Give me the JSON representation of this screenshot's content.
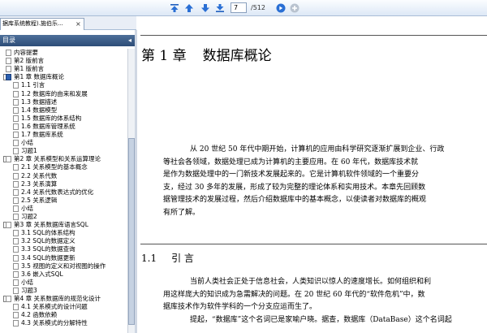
{
  "toolbar": {
    "current_page": "7",
    "page_total": "/512"
  },
  "tab": {
    "title": "据库系统教程).施伯乐...",
    "close": "×"
  },
  "sidebar": {
    "title": "目录",
    "collapse": "◂",
    "items": [
      {
        "label": "内容提要",
        "level": 0,
        "expander": ""
      },
      {
        "label": "第2 版前言",
        "level": 0,
        "expander": ""
      },
      {
        "label": "第1 版前言",
        "level": 0,
        "expander": ""
      },
      {
        "label": "第1 章  数据库概论",
        "level": 0,
        "expander": "-",
        "selected": true
      },
      {
        "label": "1.1  引言",
        "level": 1
      },
      {
        "label": "1.2  数据库的由来和发展",
        "level": 1
      },
      {
        "label": "1.3  数据描述",
        "level": 1
      },
      {
        "label": "1.4  数据模型",
        "level": 1
      },
      {
        "label": "1.5  数据库的体系结构",
        "level": 1
      },
      {
        "label": "1.6  数据库管理系统",
        "level": 1
      },
      {
        "label": "1.7  数据库系统",
        "level": 1
      },
      {
        "label": "小结",
        "level": 1
      },
      {
        "label": "习题1",
        "level": 1
      },
      {
        "label": "第2 章  关系模型和关系运算理论",
        "level": 0,
        "expander": "-"
      },
      {
        "label": "2.1  关系模型的基本概念",
        "level": 1
      },
      {
        "label": "2.2  关系代数",
        "level": 1
      },
      {
        "label": "2.3  关系演算",
        "level": 1
      },
      {
        "label": "2.4  关系代数表达式的优化",
        "level": 1
      },
      {
        "label": "2.5  关系逻辑",
        "level": 1
      },
      {
        "label": "小结",
        "level": 1
      },
      {
        "label": "习题2",
        "level": 1
      },
      {
        "label": "第3 章  关系数据库语言SQL",
        "level": 0,
        "expander": "-"
      },
      {
        "label": "3.1  SQL的体系结构",
        "level": 1
      },
      {
        "label": "3.2  SQL的数据定义",
        "level": 1
      },
      {
        "label": "3.3  SQL的数据查询",
        "level": 1
      },
      {
        "label": "3.4  SQL的数据更新",
        "level": 1
      },
      {
        "label": "3.5  视图的定义和对视图的操作",
        "level": 1
      },
      {
        "label": "3.6  嵌入式SQL",
        "level": 1
      },
      {
        "label": "小结",
        "level": 1
      },
      {
        "label": "习题3",
        "level": 1
      },
      {
        "label": "第4 章  关系数据库的规范化设计",
        "level": 0,
        "expander": "-"
      },
      {
        "label": "4.1  关系模式的设计问题",
        "level": 1
      },
      {
        "label": "4.2  函数依赖",
        "level": 1
      },
      {
        "label": "4.3  关系模式的分解特性",
        "level": 1
      }
    ]
  },
  "document": {
    "chapter_num": "第 1 章",
    "chapter_name": "数据库概论",
    "intro_lines": [
      "从 20 世纪 50 年代中期开始，计算机的应用由科学研究逐渐扩展到企业、行政",
      "等社会各领域，数据处理已成为计算机的主要应用。在 60 年代，数据库技术就",
      "是作为数据处理中的一门新技术发展起来的。它是计算机软件领域的一个重要分",
      "支，经过 30 多年的发展，形成了较为完整的理论体系和实用技术。本章先回顾数",
      "据管理技术的发展过程，然后介绍数据库中的基本概念，以使读者对数据库的概观",
      "有所了解。"
    ],
    "section_num": "1.1",
    "section_name": "引    言",
    "section_lines": [
      "当前人类社会正处于信息社会，人类知识以惊人的速度增长。如何组织和利",
      "用这样庞大的知识成为急需解决的问题。在 20 世纪 60 年代的“软件危机”中，数",
      "据库技术作为软件学科的一个分支应运而生了。",
      "提起，“数据库”这个名词已是家喻户晓。据查，数据库（DataBase）这个名词起"
    ]
  }
}
